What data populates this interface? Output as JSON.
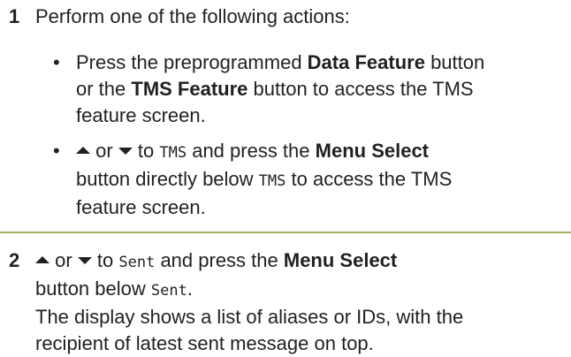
{
  "steps": [
    {
      "number": "1",
      "text": "Perform one of the following actions:",
      "bullets": [
        {
          "symbol": "•",
          "line1_prefix": "Press the preprogrammed ",
          "line1_bold": "Data Feature",
          "line1_suffix": " button",
          "line2_prefix": "or the ",
          "line2_bold": "TMS Feature",
          "line2_suffix": " button to access the TMS",
          "line3": "feature screen."
        },
        {
          "symbol": "•",
          "up_arrow_icon": "up-arrow-key",
          "or_text": " or ",
          "down_arrow_icon": "down-arrow-key",
          "to_text": " to ",
          "tms_code": "TMS",
          "and_press": " and press the ",
          "menu_select": "Menu Select",
          "line2_prefix": "button directly below ",
          "tms_code2": "TMS",
          "line2_suffix": " to access the TMS",
          "line3": "feature screen."
        }
      ]
    },
    {
      "number": "2",
      "up_arrow_icon": "up-arrow-key",
      "or_text": " or ",
      "down_arrow_icon": "down-arrow-key",
      "to_text": " to ",
      "sent_code": "Sent",
      "and_press": " and press the ",
      "menu_select": "Menu Select",
      "line2_prefix": "button below ",
      "sent_code2": "Sent",
      "line2_suffix": ".",
      "line3": "The display shows a list of aliases or IDs, with the",
      "line4": "recipient of latest sent message on top."
    }
  ],
  "colors": {
    "text": "#231f20",
    "divider": "#9bb35a"
  }
}
